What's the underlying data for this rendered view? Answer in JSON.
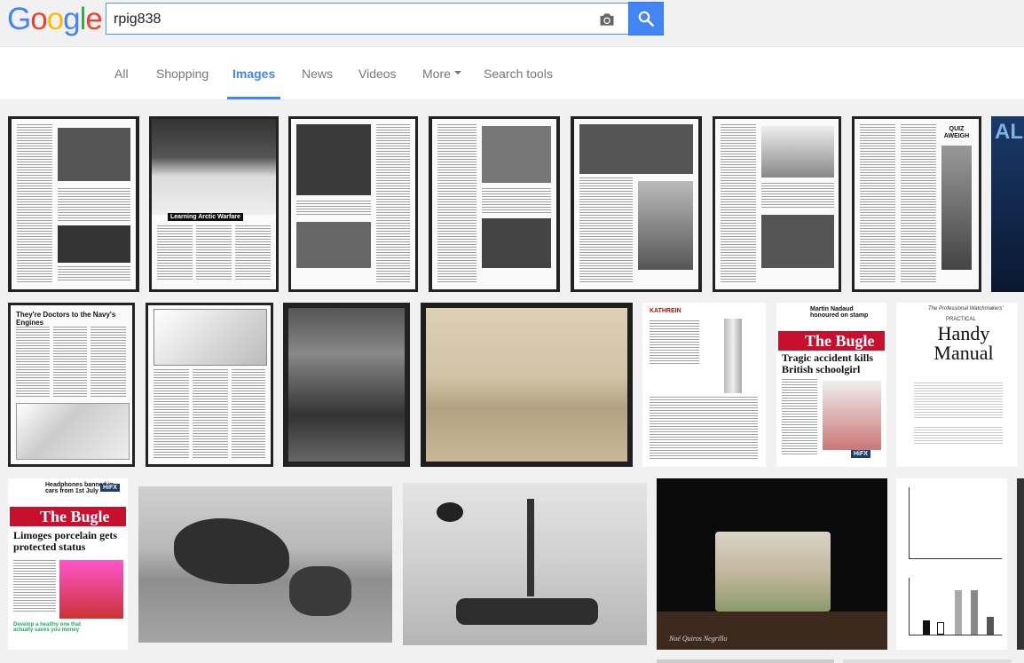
{
  "logo": {
    "letters": [
      "G",
      "o",
      "o",
      "g",
      "l",
      "e"
    ],
    "colors": [
      "#4285f4",
      "#ea4335",
      "#fbbc05",
      "#4285f4",
      "#34a853",
      "#ea4335"
    ]
  },
  "search": {
    "value": "rpig838",
    "camera_icon": "camera-icon",
    "search_icon": "magnifier-icon"
  },
  "tabs": [
    {
      "label": "All"
    },
    {
      "label": "Shopping"
    },
    {
      "label": "Images",
      "active": true
    },
    {
      "label": "News"
    },
    {
      "label": "Videos"
    },
    {
      "label": "More"
    },
    {
      "label": "Search tools"
    }
  ],
  "colors": {
    "accent": "#4285f4",
    "header_bg": "#f1f1f1"
  },
  "results": {
    "arctic_caption": "Learning Arctic Warfare",
    "quiz_title": "QUIZ AWEIGH",
    "navy_doctors_title": "They're Doctors to the Navy's Engines",
    "kathrein_logo": "KATHREIN",
    "bugle1": {
      "kicker": "Martin Nadaud honoured on stamp",
      "masthead": "The Bugle",
      "headline": "Tragic accident kills British schoolgirl",
      "badge": "HiFX"
    },
    "handy_manual": {
      "kicker": "The Professional Watchmakers'",
      "small": "PRACTICAL",
      "title": "Handy Manual"
    },
    "bugle2": {
      "kicker": "Headphones banned in cars from 1st July",
      "masthead": "The Bugle",
      "headline": "Limoges porcelain gets protected status",
      "badge": "HiFX",
      "footer": "Develop a healthy one that actually saves you money"
    },
    "signature": "Noé Quiros Negrillo"
  }
}
